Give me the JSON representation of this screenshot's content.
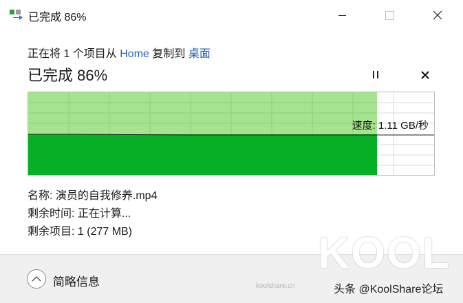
{
  "window": {
    "title": "已完成 86%",
    "app_icon": "file-copy-icon",
    "controls": {
      "minimize": "minimize-icon",
      "maximize": "maximize-icon",
      "close": "close-icon"
    }
  },
  "transfer": {
    "subtitle_prefix": "正在将 1 个项目从 ",
    "source": "Home",
    "subtitle_middle": " 复制到 ",
    "destination": "桌面",
    "status": "已完成 86%",
    "progress_percent": 86,
    "speed_label": "速度: 1.11 GB/秒"
  },
  "details": {
    "name": "名称: 演员的自我修养.mp4",
    "time_remaining": "剩余时间: 正在计算...",
    "items_remaining": "剩余项目: 1 (277 MB)"
  },
  "footer": {
    "toggle_label": "简略信息",
    "toggle_icon": "chevron-up-icon"
  },
  "watermark": {
    "logo_text": "KOOL",
    "site": "koolshare.cn",
    "credit": "头条 @KoolShare论坛"
  },
  "colors": {
    "progress_fill": "#06b025",
    "graph_light": "#a6e38f",
    "link": "#1f5fbf"
  }
}
